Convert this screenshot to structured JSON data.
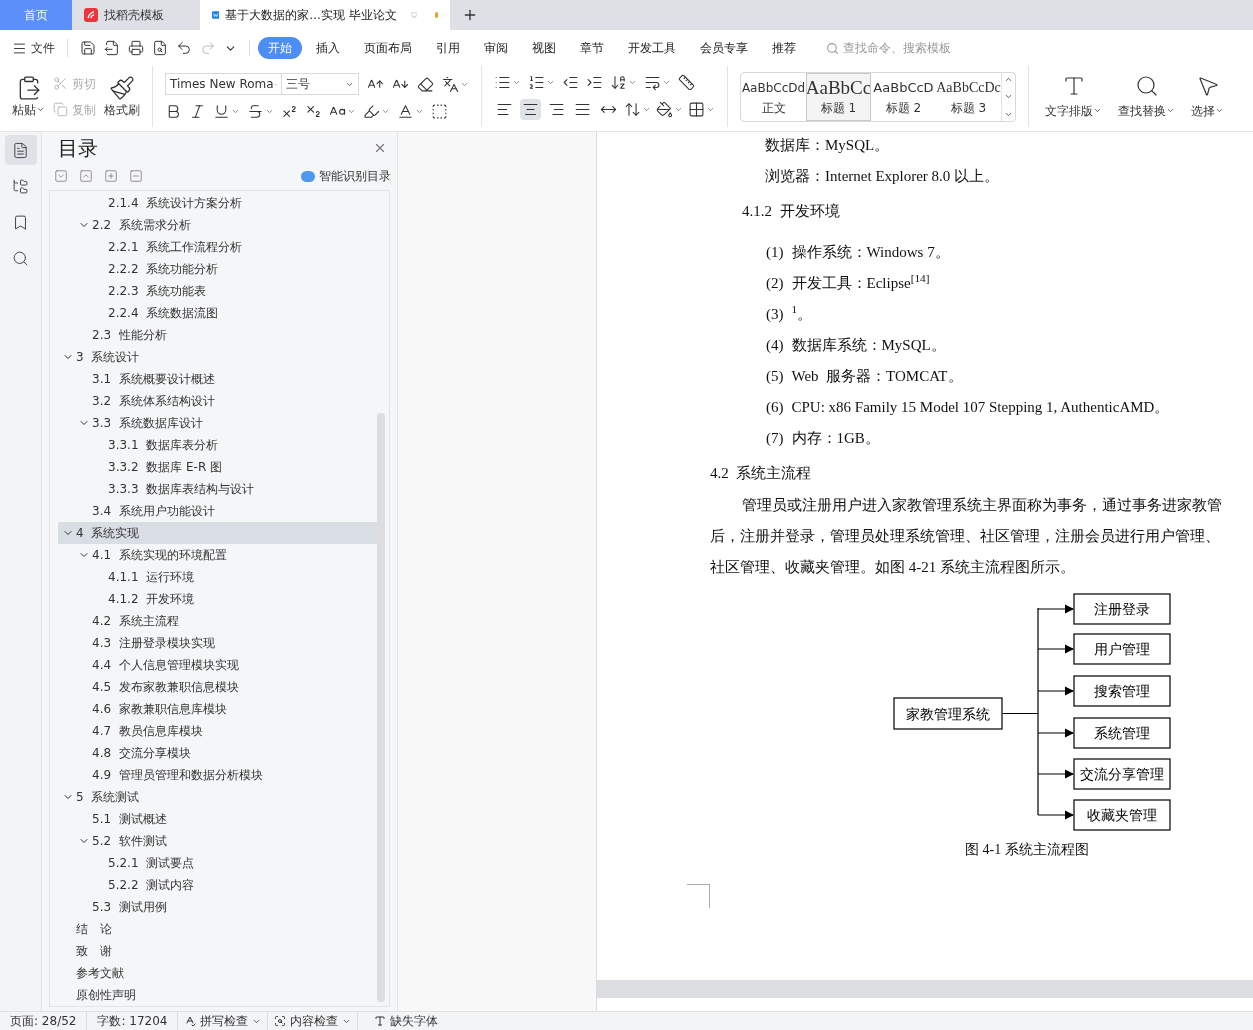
{
  "tabs": [
    {
      "kind": "home",
      "label": "首页",
      "selected": false
    },
    {
      "kind": "template",
      "label": "找稻壳模板",
      "selected": false
    },
    {
      "kind": "doc",
      "label": "基于大数据的家...实现 毕业论文",
      "selected": true,
      "modified": true
    }
  ],
  "menu": {
    "file": "文件",
    "tabs": [
      {
        "label": "开始",
        "selected": true
      },
      {
        "label": "插入",
        "selected": false
      },
      {
        "label": "页面布局",
        "selected": false
      },
      {
        "label": "引用",
        "selected": false
      },
      {
        "label": "审阅",
        "selected": false
      },
      {
        "label": "视图",
        "selected": false
      },
      {
        "label": "章节",
        "selected": false
      },
      {
        "label": "开发工具",
        "selected": false
      },
      {
        "label": "会员专享",
        "selected": false
      },
      {
        "label": "推荐",
        "selected": false
      }
    ],
    "search": {
      "placeholder": "查找命令、搜索模板"
    }
  },
  "ribbon": {
    "paste": {
      "label": "粘贴"
    },
    "cut": {
      "label": "剪切",
      "disabled": true
    },
    "copy": {
      "label": "复制",
      "disabled": true
    },
    "format_painter": {
      "label": "格式刷"
    },
    "font": {
      "name": "Times New Roma",
      "size": "三号"
    },
    "align": [
      {
        "kind": "left",
        "selected": false
      },
      {
        "kind": "center",
        "selected": true
      },
      {
        "kind": "right",
        "selected": false
      },
      {
        "kind": "justify",
        "selected": false
      },
      {
        "kind": "distributed",
        "selected": false
      }
    ],
    "styles": [
      {
        "kind": "body",
        "preview": "AaBbCcDd",
        "label": "正文",
        "selected": false
      },
      {
        "kind": "h1",
        "preview": "AaBbCc",
        "label": "标题 1",
        "selected": true
      },
      {
        "kind": "h2",
        "preview": "AaBbCcD",
        "label": "标题 2",
        "selected": false
      },
      {
        "kind": "h3",
        "preview": "AaBbCcDc",
        "label": "标题 3",
        "selected": false
      }
    ],
    "tools": [
      {
        "kind": "layout",
        "label": "文字排版"
      },
      {
        "kind": "find",
        "label": "查找替换"
      },
      {
        "kind": "select",
        "label": "选择"
      }
    ]
  },
  "sidebar": {
    "items": [
      {
        "kind": "toc",
        "selected": true
      },
      {
        "kind": "nav",
        "selected": false
      },
      {
        "kind": "bookmark",
        "selected": false
      },
      {
        "kind": "search",
        "selected": false
      }
    ]
  },
  "toc": {
    "title": "目录",
    "smart_button": "智能识别目录",
    "items": [
      {
        "children": [
          {
            "children": [
              {
                "label": "2.1.4  系统设计方案分析",
                "selected": false
              }
            ]
          },
          {
            "label": "2.2  系统需求分析",
            "selected": false,
            "expanded": true,
            "children": [
              {
                "label": "2.2.1  系统工作流程分析",
                "selected": false
              },
              {
                "label": "2.2.2  系统功能分析",
                "selected": false
              },
              {
                "label": "2.2.3  系统功能表",
                "selected": false
              },
              {
                "label": "2.2.4  系统数据流图",
                "selected": false
              }
            ]
          },
          {
            "label": "2.3  性能分析",
            "selected": false
          }
        ]
      },
      {
        "label": "3  系统设计",
        "selected": false,
        "expanded": true,
        "children": [
          {
            "label": "3.1  系统概要设计概述",
            "selected": false
          },
          {
            "label": "3.2  系统体系结构设计",
            "selected": false
          },
          {
            "label": "3.3  系统数据库设计",
            "selected": false,
            "expanded": true,
            "children": [
              {
                "label": "3.3.1  数据库表分析",
                "selected": false
              },
              {
                "label": "3.3.2  数据库 E-R 图",
                "selected": false
              },
              {
                "label": "3.3.3  数据库表结构与设计",
                "selected": false
              }
            ]
          },
          {
            "label": "3.4  系统用户功能设计",
            "selected": false
          }
        ]
      },
      {
        "label": "4  系统实现",
        "selected": true,
        "expanded": true,
        "children": [
          {
            "label": "4.1  系统实现的环境配置",
            "selected": false,
            "expanded": true,
            "children": [
              {
                "label": "4.1.1  运行环境",
                "selected": false
              },
              {
                "label": "4.1.2  开发环境",
                "selected": false
              }
            ]
          },
          {
            "label": "4.2  系统主流程",
            "selected": false
          },
          {
            "label": "4.3  注册登录模块实现",
            "selected": false
          },
          {
            "label": "4.4  个人信息管理模块实现",
            "selected": false
          },
          {
            "label": "4.5  发布家教兼职信息模块",
            "selected": false
          },
          {
            "label": "4.6  家教兼职信息库模块",
            "selected": false
          },
          {
            "label": "4.7  教员信息库模块",
            "selected": false
          },
          {
            "label": "4.8  交流分享模块",
            "selected": false
          },
          {
            "label": "4.9  管理员管理和数据分析模块",
            "selected": false
          }
        ]
      },
      {
        "label": "5  系统测试",
        "selected": false,
        "expanded": true,
        "children": [
          {
            "label": "5.1  测试概述",
            "selected": false
          },
          {
            "label": "5.2  软件测试",
            "selected": false,
            "expanded": true,
            "children": [
              {
                "label": "5.2.1  测试要点",
                "selected": false
              },
              {
                "label": "5.2.2  测试内容",
                "selected": false
              }
            ]
          },
          {
            "label": "5.3  测试用例",
            "selected": false
          }
        ]
      },
      {
        "label": "结　论",
        "selected": false
      },
      {
        "label": "致　谢",
        "selected": false
      },
      {
        "label": "参考文献",
        "selected": false
      },
      {
        "label": "原创性声明",
        "selected": false
      }
    ]
  },
  "document": {
    "blocks": [
      {
        "kind": "para",
        "text": "数据库：MySQL。"
      },
      {
        "kind": "para",
        "text": "浏览器：Internet Explorer 8.0 以上。"
      },
      {
        "kind": "h3",
        "text": "4.1.2  开发环境"
      },
      {
        "kind": "item",
        "number": "(1)",
        "text": "操作系统：Windows 7。"
      },
      {
        "kind": "item",
        "number": "(2)",
        "text": "开发工具：Eclipse$^{[14]}$"
      },
      {
        "kind": "item",
        "number": "(3)",
        "text": "$^{1}$。"
      },
      {
        "kind": "item",
        "number": "(4)",
        "text": "数据库系统：MySQL。"
      },
      {
        "kind": "item",
        "number": "(5)",
        "text": "Web  服务器：TOMCAT。"
      },
      {
        "kind": "item",
        "number": "(6)",
        "text": "CPU: x86 Family 15 Model 107 Stepping 1, AuthenticAMD。"
      },
      {
        "kind": "item",
        "number": "(7)",
        "text": "内存：1GB。"
      },
      {
        "kind": "h2",
        "text": "4.2  系统主流程"
      },
      {
        "kind": "line_first",
        "text": "管理员或注册用户进入家教管理系统主界面称为事务，通过事务进家教管"
      },
      {
        "kind": "line",
        "text": "后，注册并登录，管理员处理系统管理、社区管理，注册会员进行用户管理、"
      },
      {
        "kind": "line",
        "text": "社区管理、收藏夹管理。如图 4-21 系统主流程图所示。"
      }
    ],
    "flowchart": {
      "root": "家教管理系统",
      "nodes": [
        "注册登录",
        "用户管理",
        "搜索管理",
        "系统管理",
        "交流分享管理",
        "收藏夹管理"
      ],
      "caption": "图 4-1 系统主流程图"
    }
  },
  "status_bar": {
    "page": "页面: 28/52",
    "words": "字数: 17204",
    "spell": "拼写检查",
    "content": "内容检查",
    "fonts": "缺失字体"
  }
}
